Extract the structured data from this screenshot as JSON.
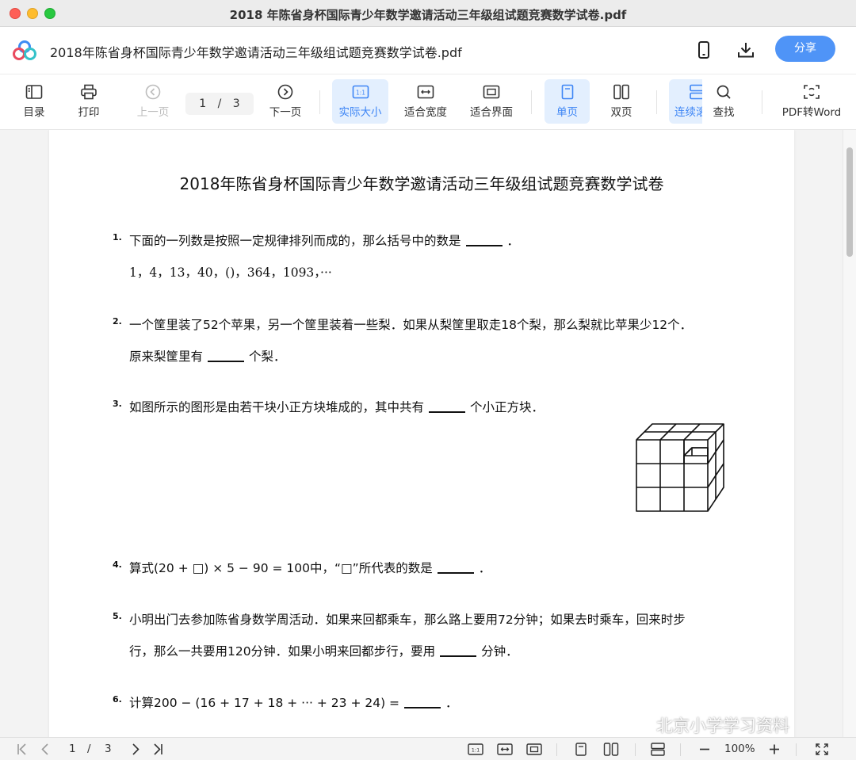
{
  "window": {
    "title": "2018 年陈省身杯国际青少年数学邀请活动三年级组试题竞赛数学试卷.pdf"
  },
  "header": {
    "doc_title": "2018年陈省身杯国际青少年数学邀请活动三年级组试题竞赛数学试卷.pdf",
    "share_label": "分享",
    "icons": [
      "cloud-logo-icon",
      "phone-icon",
      "download-icon"
    ]
  },
  "toolbar": {
    "toc": "目录",
    "print": "打印",
    "prev": "上一页",
    "page_indicator": "1 / 3",
    "next": "下一页",
    "actual_size": "实际大小",
    "fit_width": "适合宽度",
    "fit_screen": "适合界面",
    "single_page": "单页",
    "double_page": "双页",
    "continuous": "连续滚",
    "find": "查找",
    "pdf_to_word": "PDF转Word"
  },
  "document": {
    "title": "2018年陈省身杯国际青少年数学邀请活动三年级组试题竞赛数学试卷",
    "questions": [
      {
        "num": "1.",
        "lines": [
          [
            "下面的一列数是按照一定规律排列而成的，那么括号中的数是",
            "BLANK",
            "．"
          ],
          [
            "MATH:1，4，13，40，()，364，1093，···"
          ]
        ]
      },
      {
        "num": "2.",
        "lines": [
          [
            "一个筐里装了52个苹果，另一个筐里装着一些梨．如果从梨筐里取走18个梨，那么梨就比苹果少12个．"
          ],
          [
            "原来梨筐里有",
            "BLANK",
            "个梨．"
          ]
        ]
      },
      {
        "num": "3.",
        "lines": [
          [
            "如图所示的图形是由若干块小正方块堆成的，其中共有",
            "BLANK",
            "个小正方块．"
          ]
        ]
      },
      {
        "num": "4.",
        "lines": [
          [
            "算式(20 + □) × 5 − 90 = 100中，“□”所代表的数是",
            "BLANK",
            "．"
          ]
        ]
      },
      {
        "num": "5.",
        "lines": [
          [
            "小明出门去参加陈省身数学周活动．如果来回都乘车，那么路上要用72分钟；如果去时乘车，回来时步"
          ],
          [
            "行，那么一共要用120分钟．如果小明来回都步行，要用",
            "BLANK",
            "分钟．"
          ]
        ]
      },
      {
        "num": "6.",
        "lines": [
          [
            "计算200 − (16 + 17 + 18 + ··· + 23 + 24) =",
            "BLANK",
            "．"
          ]
        ]
      }
    ]
  },
  "watermark": {
    "text": "北京小学学习资料"
  },
  "bottombar": {
    "current_page": "1",
    "separator": "/",
    "total_pages": "3",
    "zoom": "100%"
  }
}
